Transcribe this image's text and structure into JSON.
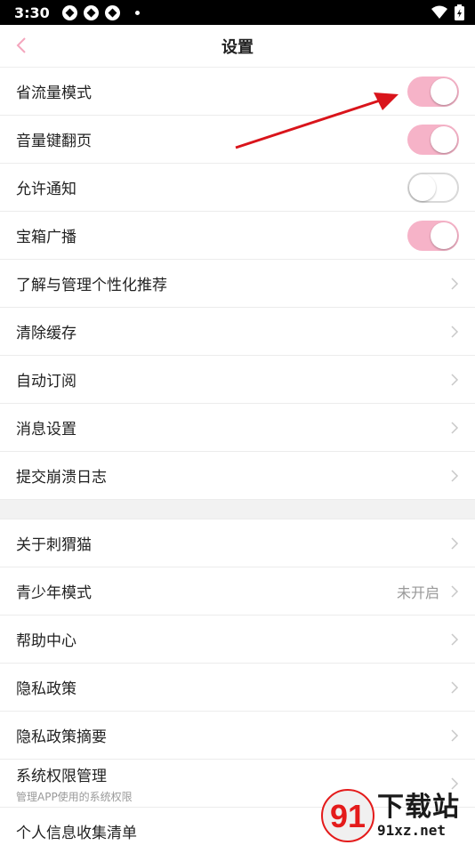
{
  "status_bar": {
    "time": "3:30"
  },
  "header": {
    "title": "设置"
  },
  "toggles": [
    {
      "label": "省流量模式",
      "on": true
    },
    {
      "label": "音量键翻页",
      "on": true
    },
    {
      "label": "允许通知",
      "on": false
    },
    {
      "label": "宝箱广播",
      "on": true
    }
  ],
  "section1": [
    {
      "label": "了解与管理个性化推荐"
    },
    {
      "label": "清除缓存"
    },
    {
      "label": "自动订阅"
    },
    {
      "label": "消息设置"
    },
    {
      "label": "提交崩溃日志"
    }
  ],
  "section2": [
    {
      "label": "关于刺猬猫"
    },
    {
      "label": "青少年模式",
      "value": "未开启"
    },
    {
      "label": "帮助中心"
    },
    {
      "label": "隐私政策"
    },
    {
      "label": "隐私政策摘要"
    }
  ],
  "permission": {
    "label": "系统权限管理",
    "sub": "管理APP使用的系统权限"
  },
  "last_item": {
    "label": "个人信息收集清单"
  },
  "watermark": {
    "brand": "下载站",
    "url": "91xz.net",
    "logo_num": "91"
  },
  "colors": {
    "accent_pink": "#f6b3c8",
    "back_arrow": "#f4a6bd",
    "annotation_arrow": "#d9141b"
  }
}
